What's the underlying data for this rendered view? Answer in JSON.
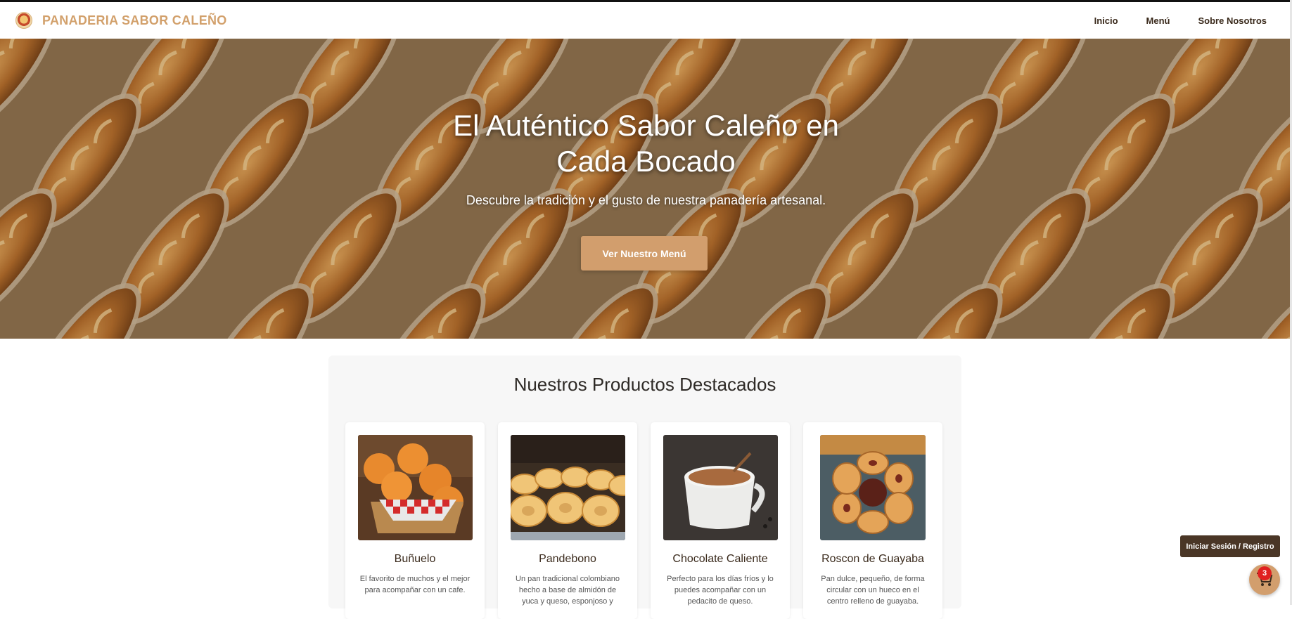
{
  "brand": {
    "name": "PANADERIA SABOR CALEÑO",
    "logo_icon": "bakery-logo-icon"
  },
  "nav": {
    "items": [
      {
        "label": "Inicio"
      },
      {
        "label": "Menú"
      },
      {
        "label": "Sobre Nosotros"
      }
    ]
  },
  "hero": {
    "title_line1": "El Auténtico Sabor Caleño en",
    "title_line2": "Cada Bocado",
    "subtitle": "Descubre la tradición y el gusto de nuestra panadería artesanal.",
    "cta_label": "Ver Nuestro Menú"
  },
  "featured": {
    "title": "Nuestros Productos Destacados",
    "products": [
      {
        "name": "Buñuelo",
        "desc_line1": "El favorito de muchos y el mejor",
        "desc_line2": "para acompañar con un cafe."
      },
      {
        "name": "Pandebono",
        "desc_line1": "Un pan tradicional colombiano",
        "desc_line2": "hecho a base de almidón de",
        "desc_line3": "yuca y queso, esponjoso y"
      },
      {
        "name": "Chocolate Caliente",
        "desc_line1": "Perfecto para los días fríos y lo",
        "desc_line2": "puedes acompañar con un",
        "desc_line3": "pedacito de queso."
      },
      {
        "name": "Roscon de Guayaba",
        "desc_line1": "Pan dulce, pequeño, de forma",
        "desc_line2": "circular con un hueco en el",
        "desc_line3": "centro relleno de guayaba."
      }
    ]
  },
  "floating": {
    "login_label": "Iniciar Sesión / Registro",
    "cart_count": "3",
    "cart_icon": "shopping-cart-icon"
  },
  "colors": {
    "brand": "#d2a06b",
    "button": "#d29e6d",
    "dark": "#4a3626",
    "badge": "#e02020"
  }
}
